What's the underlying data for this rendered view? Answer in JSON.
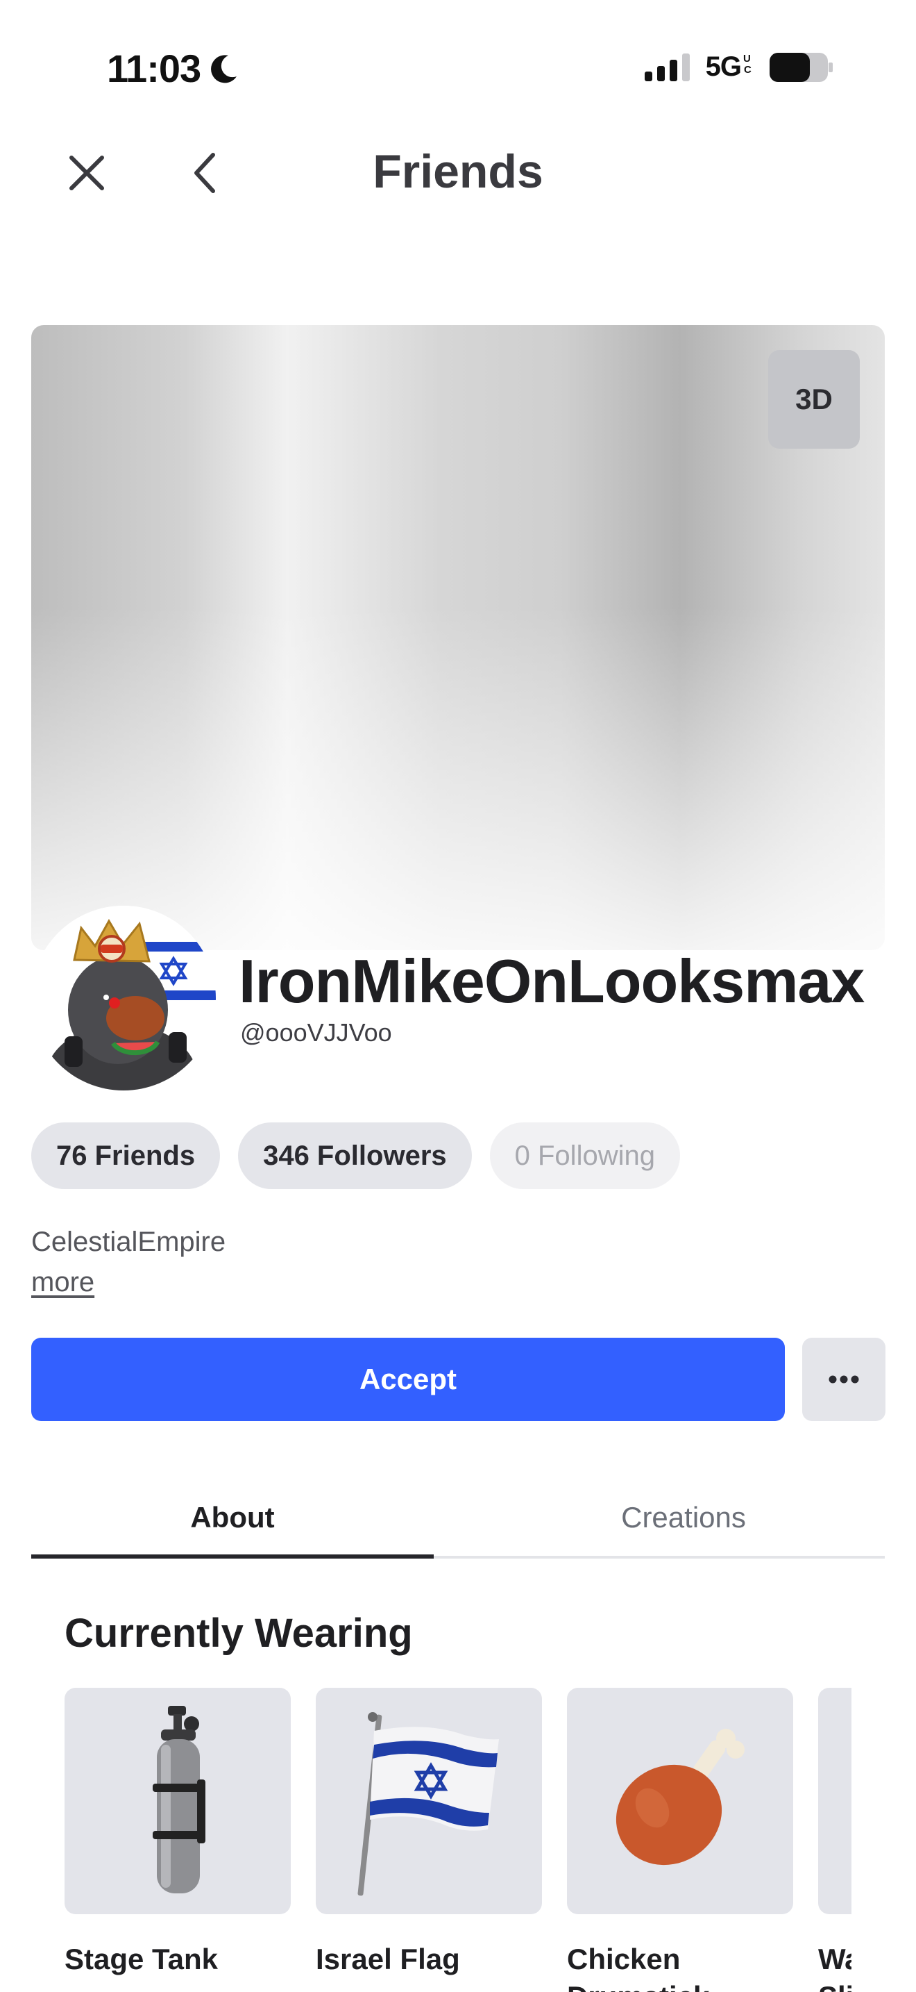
{
  "status_bar": {
    "time": "11:03",
    "network": "5G",
    "icons": [
      "moon-icon",
      "signal-icon",
      "battery-icon"
    ]
  },
  "nav": {
    "title": "Friends",
    "close_icon": "close-icon",
    "back_icon": "chevron-left-icon"
  },
  "hero": {
    "view_3d_label": "3D"
  },
  "profile": {
    "display_name": "IronMikeOnLooksmax",
    "username": "@oooVJJVoo",
    "bio": "CelestialEmpire",
    "more_label": "more"
  },
  "stats": [
    {
      "label": "76 Friends"
    },
    {
      "label": "346 Followers"
    },
    {
      "label": "0 Following"
    }
  ],
  "actions": {
    "accept_label": "Accept",
    "more_icon": "ellipsis-icon"
  },
  "tabs": [
    {
      "label": "About",
      "active": true
    },
    {
      "label": "Creations",
      "active": false
    }
  ],
  "wearing": {
    "title": "Currently Wearing",
    "items": [
      {
        "name": "Stage Tank"
      },
      {
        "name": "Israel Flag"
      },
      {
        "name": "Chicken Drumstick"
      },
      {
        "name": "Watermelon Slice"
      }
    ]
  },
  "colors": {
    "accent": "#3360ff",
    "pill_bg": "#e4e5ea"
  }
}
